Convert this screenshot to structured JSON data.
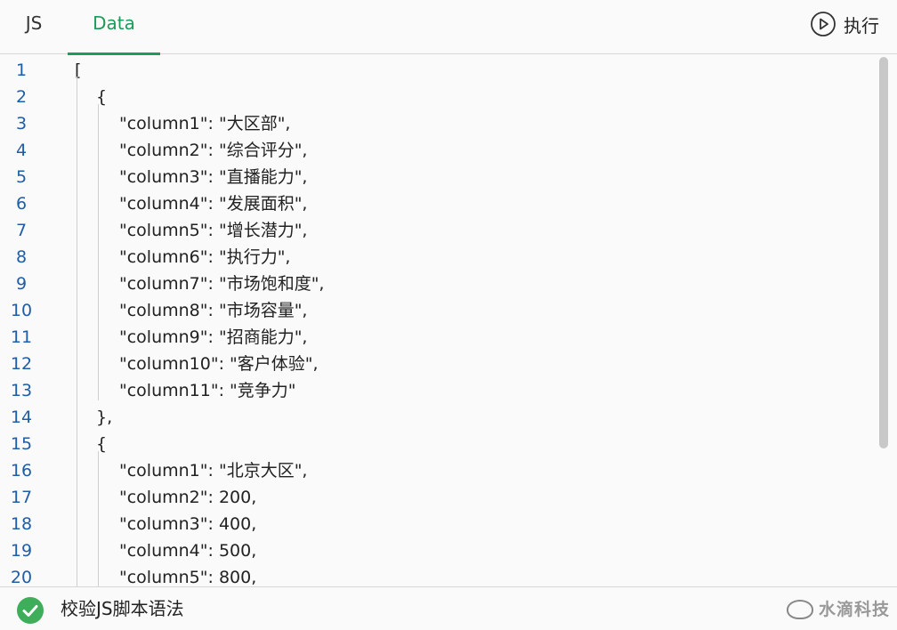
{
  "tabs": [
    {
      "label": "JS",
      "active": false
    },
    {
      "label": "Data",
      "active": true
    }
  ],
  "run_button": {
    "label": "执行",
    "icon": "play-circle-icon"
  },
  "colors": {
    "accent": "#1e9a5a",
    "line_number": "#1f5da6",
    "status_ok": "#3fae5a"
  },
  "editor": {
    "lines": [
      {
        "n": "1",
        "indent": 0,
        "text": "["
      },
      {
        "n": "2",
        "indent": 1,
        "text": "{"
      },
      {
        "n": "3",
        "indent": 2,
        "text": "\"column1\": \"大区部\","
      },
      {
        "n": "4",
        "indent": 2,
        "text": "\"column2\": \"综合评分\","
      },
      {
        "n": "5",
        "indent": 2,
        "text": "\"column3\": \"直播能力\","
      },
      {
        "n": "6",
        "indent": 2,
        "text": "\"column4\": \"发展面积\","
      },
      {
        "n": "7",
        "indent": 2,
        "text": "\"column5\": \"增长潜力\","
      },
      {
        "n": "8",
        "indent": 2,
        "text": "\"column6\": \"执行力\","
      },
      {
        "n": "9",
        "indent": 2,
        "text": "\"column7\": \"市场饱和度\","
      },
      {
        "n": "10",
        "indent": 2,
        "text": "\"column8\": \"市场容量\","
      },
      {
        "n": "11",
        "indent": 2,
        "text": "\"column9\": \"招商能力\","
      },
      {
        "n": "12",
        "indent": 2,
        "text": "\"column10\": \"客户体验\","
      },
      {
        "n": "13",
        "indent": 2,
        "text": "\"column11\": \"竞争力\""
      },
      {
        "n": "14",
        "indent": 1,
        "text": "},"
      },
      {
        "n": "15",
        "indent": 1,
        "text": "{"
      },
      {
        "n": "16",
        "indent": 2,
        "text": "\"column1\": \"北京大区\","
      },
      {
        "n": "17",
        "indent": 2,
        "text": "\"column2\": 200,"
      },
      {
        "n": "18",
        "indent": 2,
        "text": "\"column3\": 400,"
      },
      {
        "n": "19",
        "indent": 2,
        "text": "\"column4\": 500,"
      },
      {
        "n": "20",
        "indent": 2,
        "text": "\"column5\": 800,"
      }
    ]
  },
  "status": {
    "icon": "check-circle-icon",
    "text": "校验JS脚本语法"
  },
  "watermark": {
    "text": "水滴科技"
  }
}
